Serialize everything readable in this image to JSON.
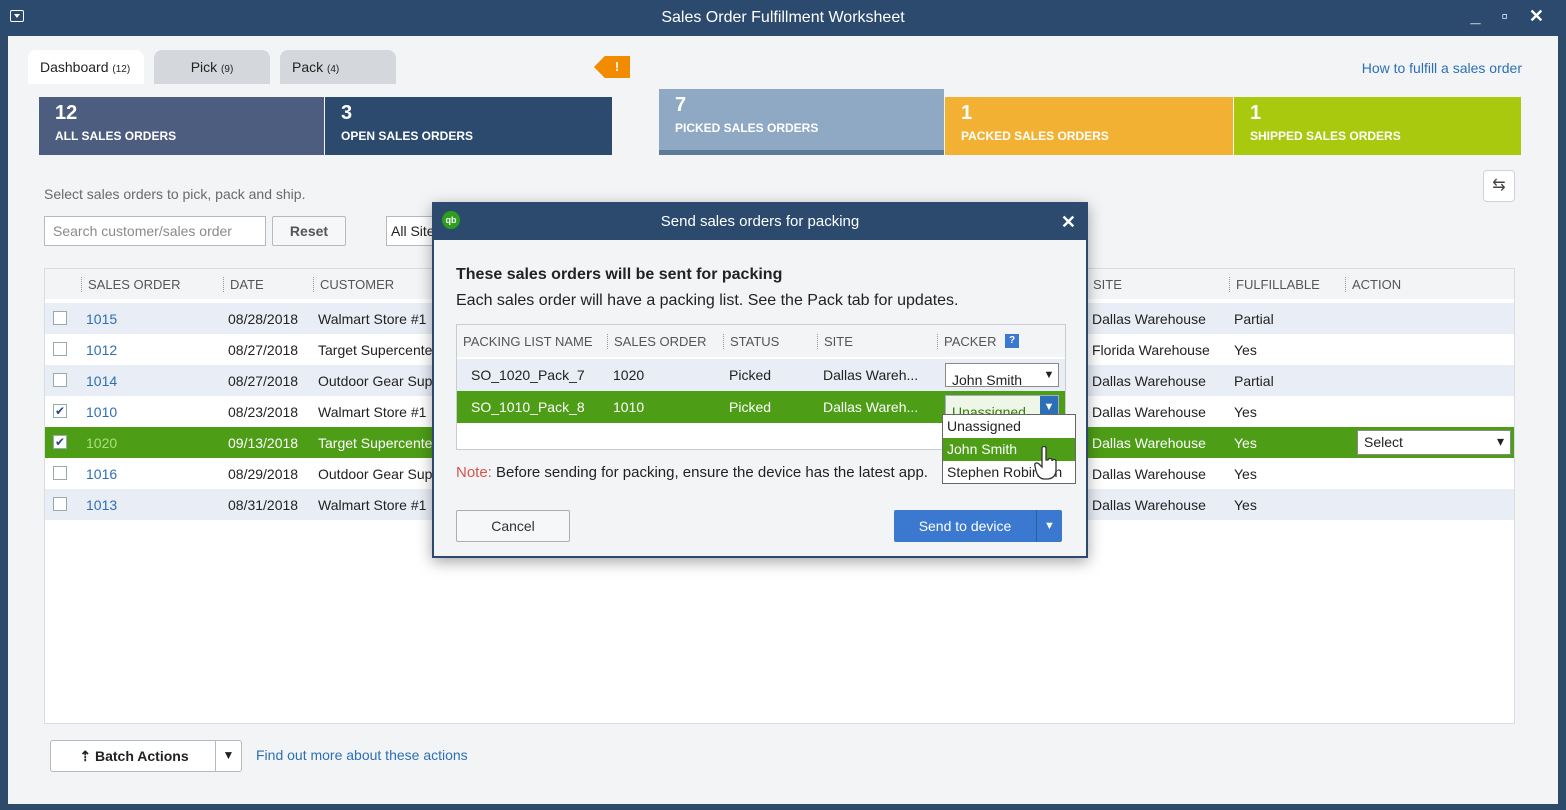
{
  "window": {
    "title": "Sales Order Fulfillment Worksheet",
    "controls": "_ ▫ ✕"
  },
  "tabs": [
    {
      "label": "Dashboard",
      "count": "(12)"
    },
    {
      "label": "Pick",
      "count": "(9)"
    },
    {
      "label": "Pack",
      "count": "(4)",
      "badge": "!"
    }
  ],
  "help_link": "How to fulfill a sales order",
  "summary": [
    {
      "num": "12",
      "label": "ALL SALES ORDERS"
    },
    {
      "num": "3",
      "label": "OPEN SALES ORDERS"
    },
    {
      "num": "7",
      "label": "PICKED SALES ORDERS"
    },
    {
      "num": "1",
      "label": "PACKED SALES ORDERS"
    },
    {
      "num": "1",
      "label": "SHIPPED SALES ORDERS"
    }
  ],
  "instructions": "Select sales orders to pick, pack and ship.",
  "search": {
    "placeholder": "Search customer/sales order"
  },
  "reset_label": "Reset",
  "site_filter": "All Sites",
  "grid": {
    "headers": [
      "SALES ORDER",
      "DATE",
      "CUSTOMER",
      "SITE",
      "FULFILLABLE",
      "ACTION"
    ],
    "rows": [
      {
        "checked": "",
        "so": "1015",
        "date": "08/28/2018",
        "customer": "Walmart Store #1",
        "site": "Dallas Warehouse",
        "fulfillable": "Partial"
      },
      {
        "checked": "",
        "so": "1012",
        "date": "08/27/2018",
        "customer": "Target Supercenter",
        "site": "Florida Warehouse",
        "fulfillable": "Yes"
      },
      {
        "checked": "",
        "so": "1014",
        "date": "08/27/2018",
        "customer": "Outdoor Gear Supply",
        "site": "Dallas Warehouse",
        "fulfillable": "Partial"
      },
      {
        "checked": "✔",
        "so": "1010",
        "date": "08/23/2018",
        "customer": "Walmart Store #1",
        "site": "Dallas Warehouse",
        "fulfillable": "Yes"
      },
      {
        "checked": "✔",
        "so": "1020",
        "date": "09/13/2018",
        "customer": "Target Supercenter",
        "site": "Dallas Warehouse",
        "fulfillable": "Yes",
        "action": "Select"
      },
      {
        "checked": "",
        "so": "1016",
        "date": "08/29/2018",
        "customer": "Outdoor Gear Supply",
        "site": "Dallas Warehouse",
        "fulfillable": "Yes"
      },
      {
        "checked": "",
        "so": "1013",
        "date": "08/31/2018",
        "customer": "Walmart Store #1",
        "site": "Dallas Warehouse",
        "fulfillable": "Yes"
      }
    ]
  },
  "batch": {
    "label": "Batch Actions",
    "link": "Find out more about these actions"
  },
  "dialog": {
    "logo": "qb",
    "title": "Send sales orders for packing",
    "heading": "These sales orders will be sent for packing",
    "subheading": "Each sales order will have a packing list. See the Pack tab for updates.",
    "headers": [
      "PACKING LIST NAME",
      "SALES ORDER",
      "STATUS",
      "SITE",
      "PACKER"
    ],
    "rows": [
      {
        "name": "SO_1020_Pack_7",
        "so": "1020",
        "status": "Picked",
        "site": "Dallas Wareh...",
        "packer": "John Smith"
      },
      {
        "name": "SO_1010_Pack_8",
        "so": "1010",
        "status": "Picked",
        "site": "Dallas Wareh...",
        "packer": "Unassigned"
      }
    ],
    "packer_options": [
      "Unassigned",
      "John Smith",
      "Stephen Robinson"
    ],
    "note_label": "Note:",
    "note_text": " Before sending for packing, ensure the device has the latest app.",
    "cancel_label": "Cancel",
    "send_label": "Send to device"
  }
}
